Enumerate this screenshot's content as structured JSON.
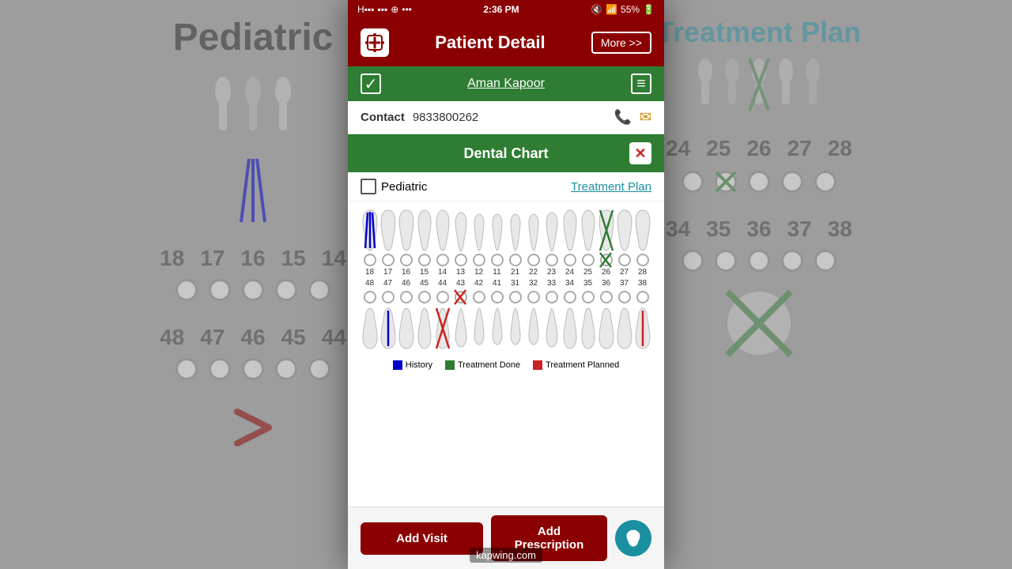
{
  "background": {
    "left_title": "Pediatric",
    "right_title": "Treatment Plan"
  },
  "status_bar": {
    "carrier": "H",
    "time": "2:36 PM",
    "battery": "55%"
  },
  "header": {
    "title": "Patient Detail",
    "more_label": "More >>"
  },
  "patient": {
    "name": "Aman Kapoor"
  },
  "contact": {
    "label": "Contact",
    "number": "9833800262"
  },
  "dental_chart": {
    "title": "Dental Chart",
    "close_label": "✕",
    "pediatric_label": "Pediatric",
    "treatment_plan_label": "Treatment Plan"
  },
  "upper_tooth_numbers": [
    "18",
    "17",
    "16",
    "15",
    "14",
    "13",
    "12",
    "11",
    "21",
    "22",
    "23",
    "24",
    "25",
    "26",
    "27",
    "28"
  ],
  "lower_tooth_numbers_top": [
    "48",
    "47",
    "46",
    "45",
    "44",
    "43",
    "42",
    "41",
    "31",
    "32",
    "33",
    "34",
    "35",
    "36",
    "37",
    "38"
  ],
  "legend": {
    "history_label": "History",
    "history_color": "#0000cc",
    "treatment_done_label": "Treatment Done",
    "treatment_done_color": "#2e7d32",
    "treatment_planned_label": "Treatment Planned",
    "treatment_planned_color": "#cc2222"
  },
  "buttons": {
    "add_visit": "Add Visit",
    "add_prescription": "Add Prescription"
  },
  "watermark": "kapwing.com"
}
